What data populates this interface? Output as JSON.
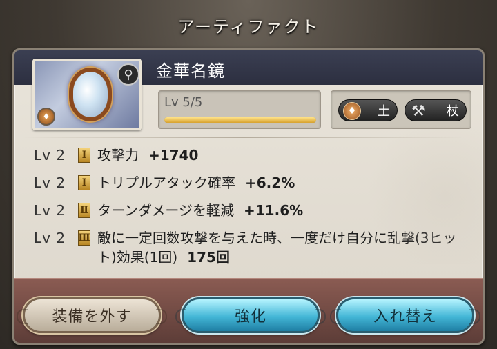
{
  "window": {
    "title": "アーティファクト"
  },
  "artifact": {
    "name": "金華名鏡",
    "level_text": "Lv 5/5",
    "level_progress": 1.0,
    "element_label": "土",
    "weapon_label": "杖",
    "element_icon": "earth-element-icon",
    "weapon_icon": "staff-icon"
  },
  "skills": [
    {
      "level": "Lv 2",
      "rank": "Ⅰ",
      "desc": "攻撃力",
      "value": "+1740"
    },
    {
      "level": "Lv 2",
      "rank": "Ⅰ",
      "desc": "トリプルアタック確率",
      "value": "+6.2%"
    },
    {
      "level": "Lv 2",
      "rank": "Ⅱ",
      "desc": "ターンダメージを軽減",
      "value": "+11.6%"
    },
    {
      "level": "Lv 2",
      "rank": "Ⅲ",
      "desc": "敵に一定回数攻撃を与えた時、一度だけ自分に乱撃(3ヒット)効果(1回)",
      "value": "175回"
    }
  ],
  "buttons": {
    "unequip": "装備を外す",
    "enhance": "強化",
    "swap": "入れ替え"
  },
  "colors": {
    "name_strip": "#2c2f40",
    "panel": "#e9e4da",
    "blue_button": "#43b6d6",
    "bottom_bar": "#7a5049"
  }
}
